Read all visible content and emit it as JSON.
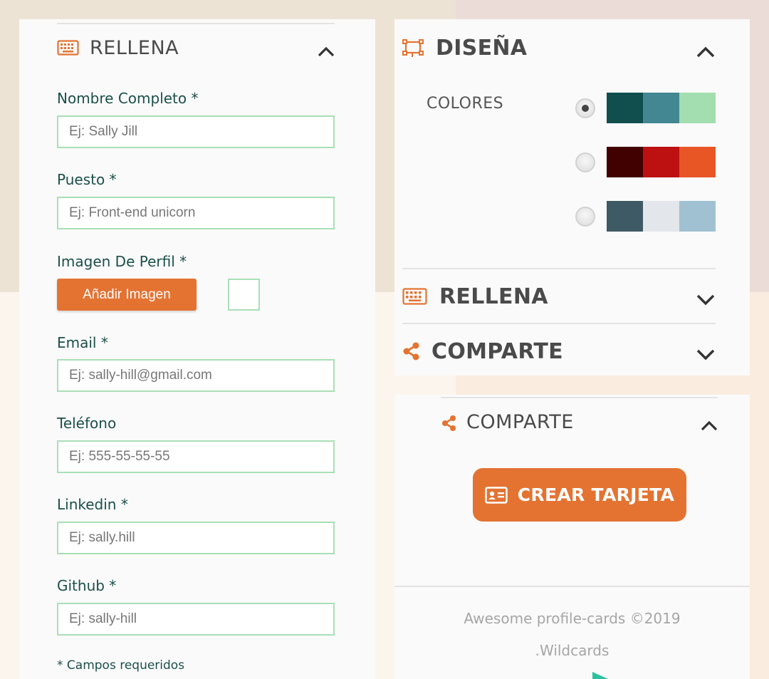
{
  "form": {
    "section_title": "RELLENA",
    "fields": [
      {
        "label": "Nombre Completo *",
        "placeholder": "Ej: Sally Jill"
      },
      {
        "label": "Puesto *",
        "placeholder": "Ej: Front-end unicorn"
      },
      {
        "label": "Email *",
        "placeholder": "Ej: sally-hill@gmail.com"
      },
      {
        "label": "Teléfono",
        "placeholder": "Ej: 555-55-55-55"
      },
      {
        "label": "Linkedin *",
        "placeholder": "Ej: sally.hill"
      },
      {
        "label": "Github *",
        "placeholder": "Ej: sally-hill"
      }
    ],
    "image_label": "Imagen De Perfil *",
    "add_image_button": "Añadir Imagen",
    "required_note": "* Campos requeridos"
  },
  "design": {
    "section_title": "DISEÑA",
    "colors_label": "COLORES",
    "palettes": [
      {
        "selected": true,
        "colors": [
          "#114e4e",
          "#438792",
          "#a2deaf"
        ]
      },
      {
        "selected": false,
        "colors": [
          "#420101",
          "#bd1010",
          "#e95626"
        ]
      },
      {
        "selected": false,
        "colors": [
          "#3e5b65",
          "#e3e6eb",
          "#a0c1d1"
        ]
      }
    ],
    "collapsed_fill_title": "RELLENA",
    "collapsed_share_title": "COMPARTE"
  },
  "share": {
    "section_title": "COMPARTE",
    "create_button": "CREAR TARJETA"
  },
  "footer": {
    "copyright": "Awesome profile-cards ©2019",
    "brand": ".Wildcards"
  },
  "colors": {
    "accent": "#e47332",
    "label": "#1b4f4a",
    "input_border": "#a8e0b6"
  }
}
